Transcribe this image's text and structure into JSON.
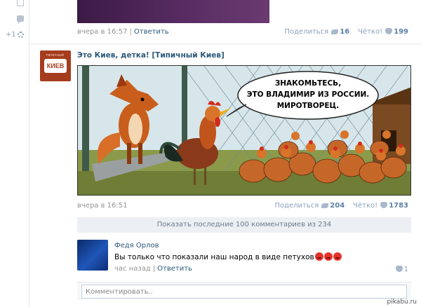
{
  "prev_post": {
    "time": "вчера в 16:57",
    "reply": "Ответить",
    "share_label": "Поделиться",
    "share_count": "16",
    "like_label": "Чётко!",
    "like_count": "199"
  },
  "rail": {
    "counter": "+1"
  },
  "post": {
    "title": "Это Киев, детка! [Типичный Киев]",
    "avatar_text": "КИЕВ",
    "avatar_small": "типичный",
    "cartoon_text_line1": "ЗНАКОМЬТЕСЬ,",
    "cartoon_text_line2": "ЭТО ВЛАДИМИР ИЗ РОССИИ.",
    "cartoon_text_line3": "МИРОТВОРЕЦ.",
    "time": "вчера в 16:51",
    "share_label": "Поделиться",
    "share_count": "204",
    "like_label": "Чётко!",
    "like_count": "1783"
  },
  "comments": {
    "show_more": "Показать последние 100 комментариев из 234",
    "item": {
      "author": "Федя Орлов",
      "text": "Вы только что показали наш народ в виде петухов",
      "time": "час назад",
      "reply": "Ответить",
      "likes": "1"
    },
    "input_placeholder": "Комментировать.."
  },
  "watermark": "pikabu.ru",
  "colors": {
    "link": "#2b587a",
    "muted": "#939393",
    "accent_count": "#5b7fa6"
  }
}
